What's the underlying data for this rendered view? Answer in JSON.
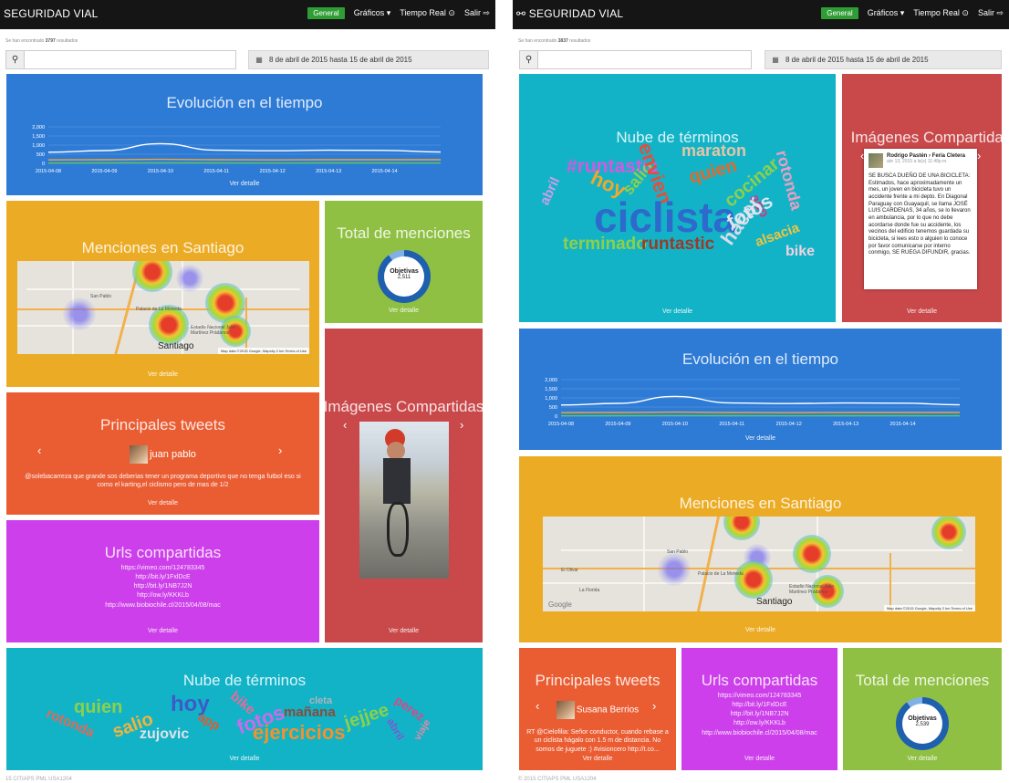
{
  "brand": "SEGURIDAD VIAL",
  "nav": {
    "active": "General",
    "graficos": "Gráficos ▾",
    "tiempo": "Tiempo Real ⊙",
    "salir": "Salir ⇨"
  },
  "left": {
    "found": {
      "prefix": "Se han encontrado",
      "count": "3797",
      "suffix": "resultados"
    },
    "date_range": "8 de abril de 2015 hasta 15 de abril de 2015",
    "donut": {
      "label": "Objetivas",
      "value": "2,511",
      "fraction": 0.9
    },
    "tweet": {
      "user": "juan pablo",
      "text": "@solebacarreza que grande sos deberias tener un programa deportivo que no tenga futbol eso si como el karting,el ciclismo pero de mas de 1/2"
    },
    "urls": [
      "https://vimeo.com/124783345",
      "http://bit.ly/1FxlDcE",
      "http://bit.ly/1NB7J2N",
      "http://ow.ly/KKKLb",
      "http://www.biobiochile.cl/2015/04/08/mac"
    ],
    "words": [
      "quien",
      "hoy",
      "bike",
      "fotos",
      "cleta",
      "mañana",
      "jejjee",
      "perez",
      "rotonda",
      "salio",
      "zujovic",
      "app",
      "ejercicios",
      "abril",
      "viaje"
    ],
    "copyright": "15 CITIAPS PML USA1204"
  },
  "right": {
    "found": {
      "prefix": "Se han encontrado",
      "count": "3837",
      "suffix": "resultados"
    },
    "date_range": "8 de abril de 2015 hasta 15 de abril de 2015",
    "donut": {
      "label": "Objetivas",
      "value": "2,539",
      "fraction": 0.9
    },
    "tweet": {
      "user": "Susana Berrios",
      "text": "RT @Cielofilia: Señor conductor, cuando rebase a un ciclista hágalo con 1.5 m de distancia. No somos de juguete :) #visioncero http://t.co..."
    },
    "urls": [
      "https://vimeo.com/124783345",
      "http://bit.ly/1FxlDcE",
      "http://bit.ly/1NB7J2N",
      "http://ow.ly/KKKLb",
      "http://www.biobiochile.cl/2015/04/08/mac"
    ],
    "words": [
      "#runtastic",
      "hoy",
      "salio",
      "envien",
      "maraton",
      "quien",
      "cocinar",
      "rotonda",
      "ciclista",
      "app",
      "hacer",
      "fotos",
      "abril",
      "terminado",
      "runtastic",
      "alsacia",
      "bike"
    ],
    "fb": {
      "name": "Rodrigo Pastén › Feria Cletera",
      "date": "abr 13, 2015 a la(s) 11:48p.m.",
      "text": "SE BUSCA DUEÑO DE UNA BICICLETA: Estimados, hace aproximadamente un mes, un joven en bicicleta tuvo un accidente frente a mi depto. En Diagonal Paraguay con Guayaquil, se llama JOSÉ LUIS CARDENAS, 34 años, se lo llevaron en ambulancia, por lo que no debe acordarse donde fue su accidente, los vecinos del edificio tenemos guardada su bicicleta, si lees esto o alguien lo conoce por favor comunicarse por interno conmigo, SE RUEGA DIFUNDIR, gracias."
    },
    "copyright": "© 2015 CITIAPS PML USA1204"
  },
  "titles": {
    "evolucion": "Evolución en el tiempo",
    "menciones": "Menciones en Santiago",
    "total": "Total de menciones",
    "imagenes": "Imágenes Compartidas",
    "tweets": "Principales tweets",
    "urls": "Urls compartidas",
    "nube": "Nube de términos",
    "ver": "Ver detalle"
  },
  "map": {
    "city": "Santiago",
    "labels": [
      "Palacio de La Moneda",
      "Estadio Nacional Julio Martínez Prádanos",
      "San Pablo",
      "La Florida",
      "El Olivar"
    ],
    "attribution": "Map data ©2015 Google, Mapcity   2 km   Terms of Use",
    "google": "Google"
  },
  "chart_data": {
    "type": "line",
    "x": [
      "2015-04-08",
      "2015-04-09",
      "2015-04-10",
      "2015-04-11",
      "2015-04-12",
      "2015-04-13",
      "2015-04-14"
    ],
    "yticks": [
      "2,000",
      "1,500",
      "1,000",
      "500",
      "0"
    ],
    "ylim": [
      0,
      2000
    ],
    "series": [
      {
        "color": "#ffffff",
        "values": [
          610,
          700,
          1080,
          720,
          690,
          720,
          710,
          620
        ]
      },
      {
        "color": "#f2a53a",
        "values": [
          190,
          200,
          220,
          200,
          190,
          200,
          200,
          200
        ]
      },
      {
        "color": "#5ac85a",
        "values": [
          20,
          25,
          30,
          25,
          20,
          25,
          25,
          20
        ]
      }
    ]
  }
}
